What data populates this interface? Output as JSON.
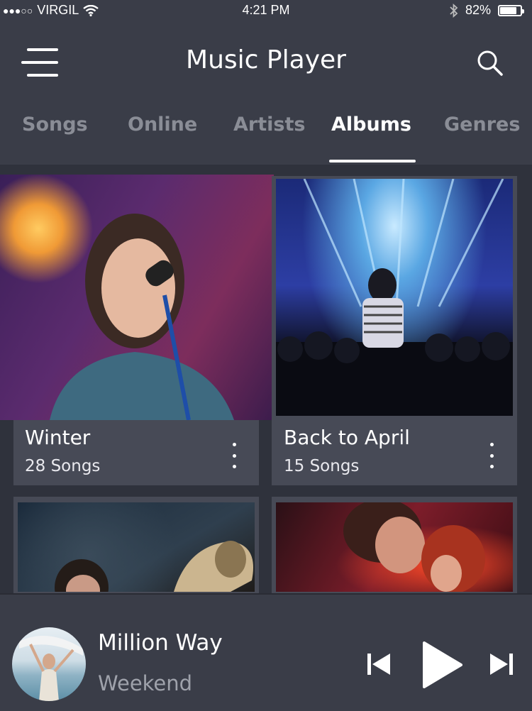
{
  "status_bar": {
    "carrier": "VIRGIL",
    "time": "4:21 PM",
    "battery_percent": "82%",
    "battery_level": 0.82,
    "signal_dots_filled": 3,
    "signal_dots_total": 5,
    "icons": [
      "signal-dots-icon",
      "wifi-icon",
      "bluetooth-icon",
      "battery-icon"
    ]
  },
  "header": {
    "title": "Music Player",
    "menu_icon": "hamburger-menu-icon",
    "search_icon": "search-icon"
  },
  "tabs": [
    {
      "label": "Songs",
      "active": false
    },
    {
      "label": "Online",
      "active": false
    },
    {
      "label": "Artists",
      "active": false
    },
    {
      "label": "Albums",
      "active": true
    },
    {
      "label": "Genres",
      "active": false
    }
  ],
  "albums": [
    {
      "title": "Winter",
      "songs": "28 Songs",
      "image": "singer-at-microphone-photo"
    },
    {
      "title": "Back to April",
      "songs": "15 Songs",
      "image": "concert-crowd-lights-photo"
    },
    {
      "title": "",
      "songs": "",
      "image": "woman-with-gramophone-photo"
    },
    {
      "title": "",
      "songs": "",
      "image": "couple-with-microphone-photo"
    }
  ],
  "now_playing": {
    "title": "Million Way",
    "artist": "Weekend",
    "cover": "woman-on-beach-photo",
    "controls": [
      "previous-icon",
      "play-icon",
      "next-icon"
    ]
  },
  "colors": {
    "background": "#2f323c",
    "bar": "#3a3d48",
    "card": "#474a56",
    "inactive_tab": "#8a8d96",
    "active_tab": "#ffffff"
  }
}
